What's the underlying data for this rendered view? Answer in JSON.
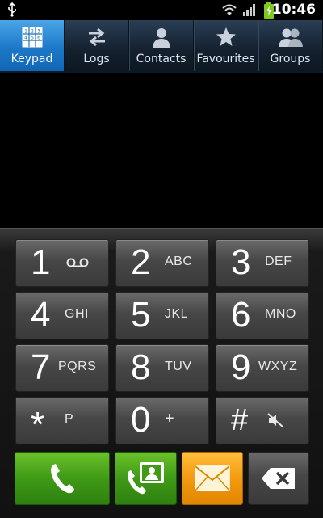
{
  "status_bar": {
    "time": "10:46"
  },
  "tabs": [
    {
      "label": "Keypad",
      "active": true
    },
    {
      "label": "Logs",
      "active": false
    },
    {
      "label": "Contacts",
      "active": false
    },
    {
      "label": "Favourites",
      "active": false
    },
    {
      "label": "Groups",
      "active": false
    }
  ],
  "keypad": {
    "keys": [
      {
        "digit": "1",
        "letters": ""
      },
      {
        "digit": "2",
        "letters": "ABC"
      },
      {
        "digit": "3",
        "letters": "DEF"
      },
      {
        "digit": "4",
        "letters": "GHI"
      },
      {
        "digit": "5",
        "letters": "JKL"
      },
      {
        "digit": "6",
        "letters": "MNO"
      },
      {
        "digit": "7",
        "letters": "PQRS"
      },
      {
        "digit": "8",
        "letters": "TUV"
      },
      {
        "digit": "9",
        "letters": "WXYZ"
      },
      {
        "digit": "*",
        "letters": "P"
      },
      {
        "digit": "0",
        "letters": "+"
      },
      {
        "digit": "#",
        "letters": ""
      }
    ]
  },
  "icons": {
    "key_1": "voicemail-icon",
    "key_hash": "mute-icon",
    "call": "phone-icon",
    "video_call": "video-call-icon",
    "message": "envelope-icon",
    "delete": "backspace-icon"
  },
  "colors": {
    "tab_active": "#1c78c8",
    "call_green": "#3f9a16",
    "message_orange": "#f39a10"
  }
}
